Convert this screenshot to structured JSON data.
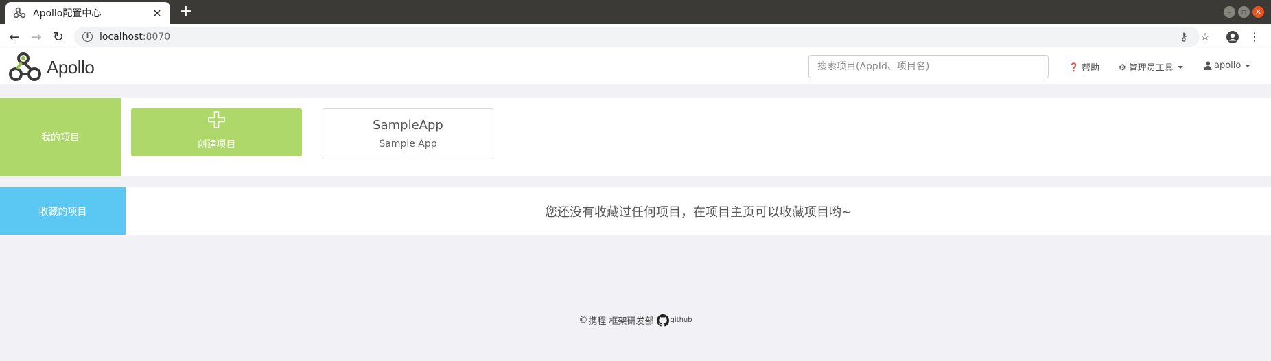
{
  "browser": {
    "tab_title": "Apollo配置中心",
    "tab_close": "✕",
    "new_tab": "+",
    "url_host": "localhost",
    "url_port": ":8070"
  },
  "header": {
    "logo_text": "Apollo",
    "search_placeholder": "搜索项目(AppId、项目名)",
    "help_label": "帮助",
    "admin_label": "管理员工具",
    "user_label": "apollo"
  },
  "my_projects": {
    "label": "我的项目",
    "create_label": "创建项目",
    "apps": [
      {
        "app_id": "SampleApp",
        "name": "Sample App"
      }
    ]
  },
  "favorites": {
    "label": "收藏的项目",
    "empty_message": "您还没有收藏过任何项目，在项目主页可以收藏项目哟~"
  },
  "footer": {
    "text": "携程 框架研发部",
    "github_label": "github"
  }
}
